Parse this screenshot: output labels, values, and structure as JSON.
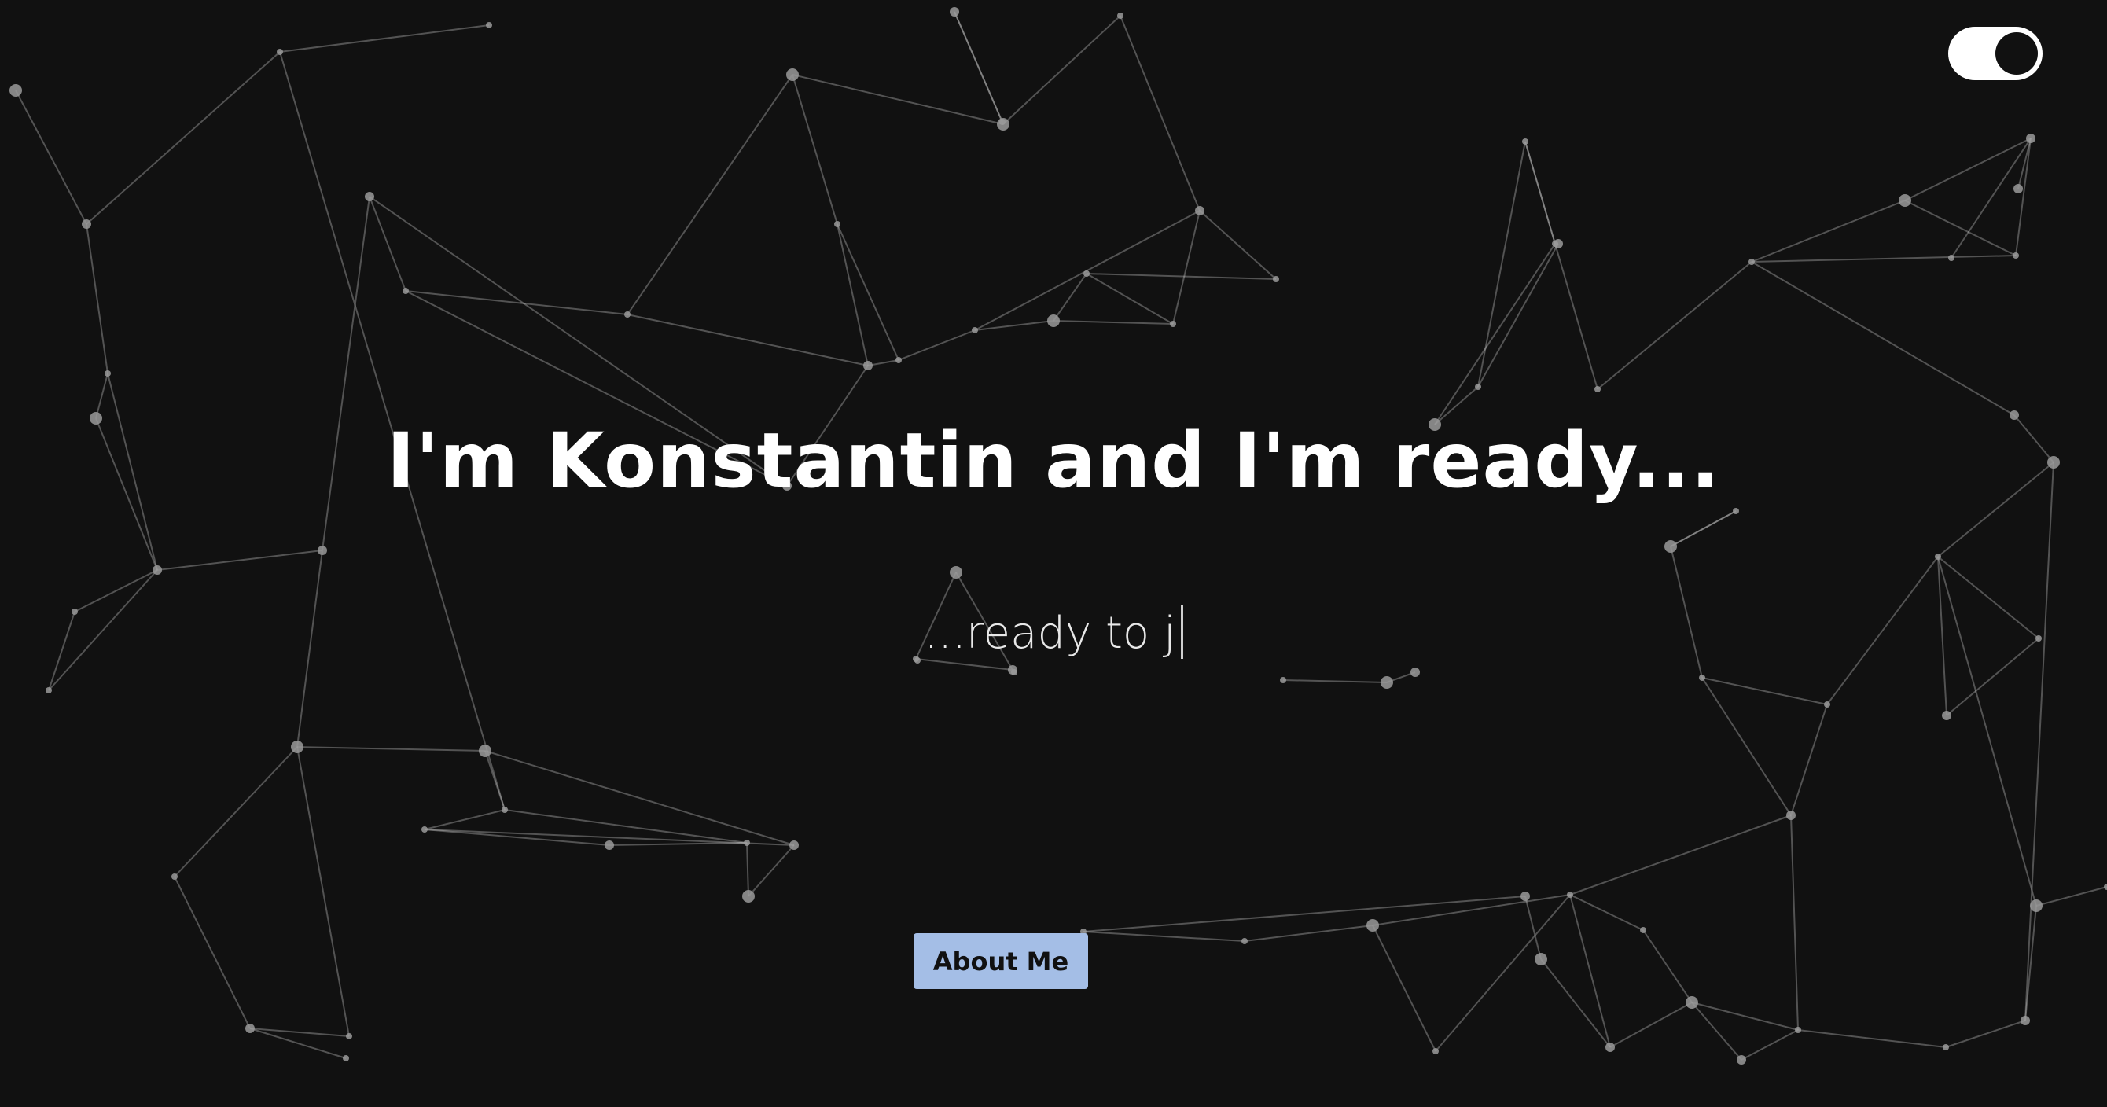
{
  "hero": {
    "headline": "I'm Konstantin and I'm ready...",
    "typed_text": "...ready to j"
  },
  "theme_toggle": {
    "state": "dark"
  },
  "cta": {
    "about_label": "About Me"
  },
  "colors": {
    "background": "#111111",
    "button": "#a4bee6",
    "text": "#ffffff"
  }
}
